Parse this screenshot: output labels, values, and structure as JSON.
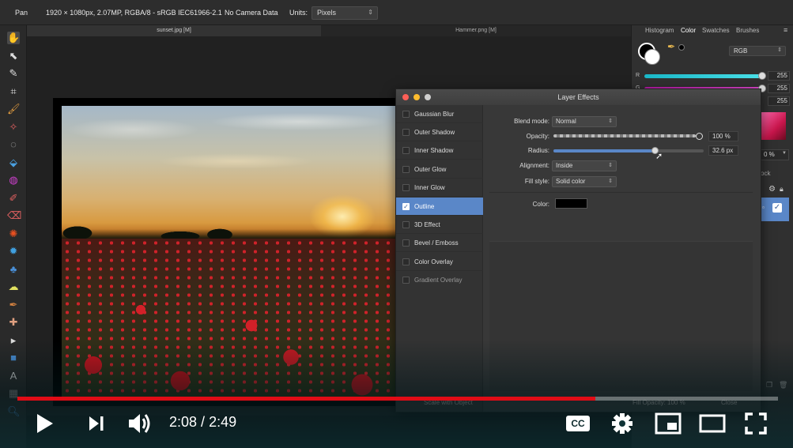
{
  "context_bar": {
    "tool_name": "Pan",
    "doc_info": "1920 × 1080px, 2.07MP, RGBA/8 - sRGB IEC61966-2.1",
    "camera": "No Camera Data",
    "units_label": "Units:",
    "units_value": "Pixels"
  },
  "document_tabs": [
    {
      "label": "sunset.jpg [M]"
    },
    {
      "label": "Hammer.png [M]"
    }
  ],
  "tools": [
    "hand-tool-icon",
    "move-tool-icon",
    "color-picker-tool-icon",
    "crop-tool-icon",
    "paint-brush-tool-icon",
    "selection-brush-tool-icon",
    "marquee-tool-icon",
    "flood-fill-tool-icon",
    "gradient-tool-icon",
    "pixel-tool-icon",
    "erase-brush-tool-icon",
    "dodge-tool-icon",
    "burn-tool-icon",
    "clone-tool-icon",
    "smudge-tool-icon",
    "blur-tool-icon",
    "healing-tool-icon",
    "node-tool-icon",
    "shape-tool-icon",
    "text-tool-icon",
    "view-tool-icon",
    "zoom-tool-icon"
  ],
  "dialog": {
    "title": "Layer Effects",
    "effects": [
      {
        "label": "Gaussian Blur",
        "checked": false
      },
      {
        "label": "Outer Shadow",
        "checked": false
      },
      {
        "label": "Inner Shadow",
        "checked": false
      },
      {
        "label": "Outer Glow",
        "checked": false
      },
      {
        "label": "Inner Glow",
        "checked": false
      },
      {
        "label": "Outline",
        "checked": true
      },
      {
        "label": "3D Effect",
        "checked": false
      },
      {
        "label": "Bevel / Emboss",
        "checked": false
      },
      {
        "label": "Color Overlay",
        "checked": false
      },
      {
        "label": "Gradient Overlay",
        "checked": false
      }
    ],
    "props": {
      "blend_mode_label": "Blend mode:",
      "blend_mode_value": "Normal",
      "opacity_label": "Opacity:",
      "opacity_value": "100 %",
      "opacity_fraction": 1.0,
      "radius_label": "Radius:",
      "radius_value": "32.6 px",
      "radius_fraction": 0.68,
      "alignment_label": "Alignment:",
      "alignment_value": "Inside",
      "fill_style_label": "Fill style:",
      "fill_style_value": "Solid color",
      "color_label": "Color:",
      "color_value": "#000000"
    },
    "faded_footer": {
      "scale_label": "Scale with Object",
      "fill_opacity": "Fill Opacity:  100 %",
      "close": "Close"
    }
  },
  "right_panel": {
    "tabs": [
      "Histogram",
      "Color",
      "Swatches",
      "Brushes"
    ],
    "active_tab": "Color",
    "mode": "RGB",
    "sliders": [
      {
        "label": "R",
        "value": "255",
        "color": "#3ad9e0"
      },
      {
        "label": "G",
        "value": "255",
        "color": "#d43ab8"
      },
      {
        "label": "B",
        "value": "255",
        "color": "#d4d43a"
      }
    ],
    "opacity_partial": "0 %",
    "lock_partial": "ock"
  },
  "player": {
    "current_time": "2:08",
    "separator": " / ",
    "duration": "2:49",
    "progress_fraction": 0.76,
    "cc_label": "CC",
    "accent": "#e00c16"
  }
}
